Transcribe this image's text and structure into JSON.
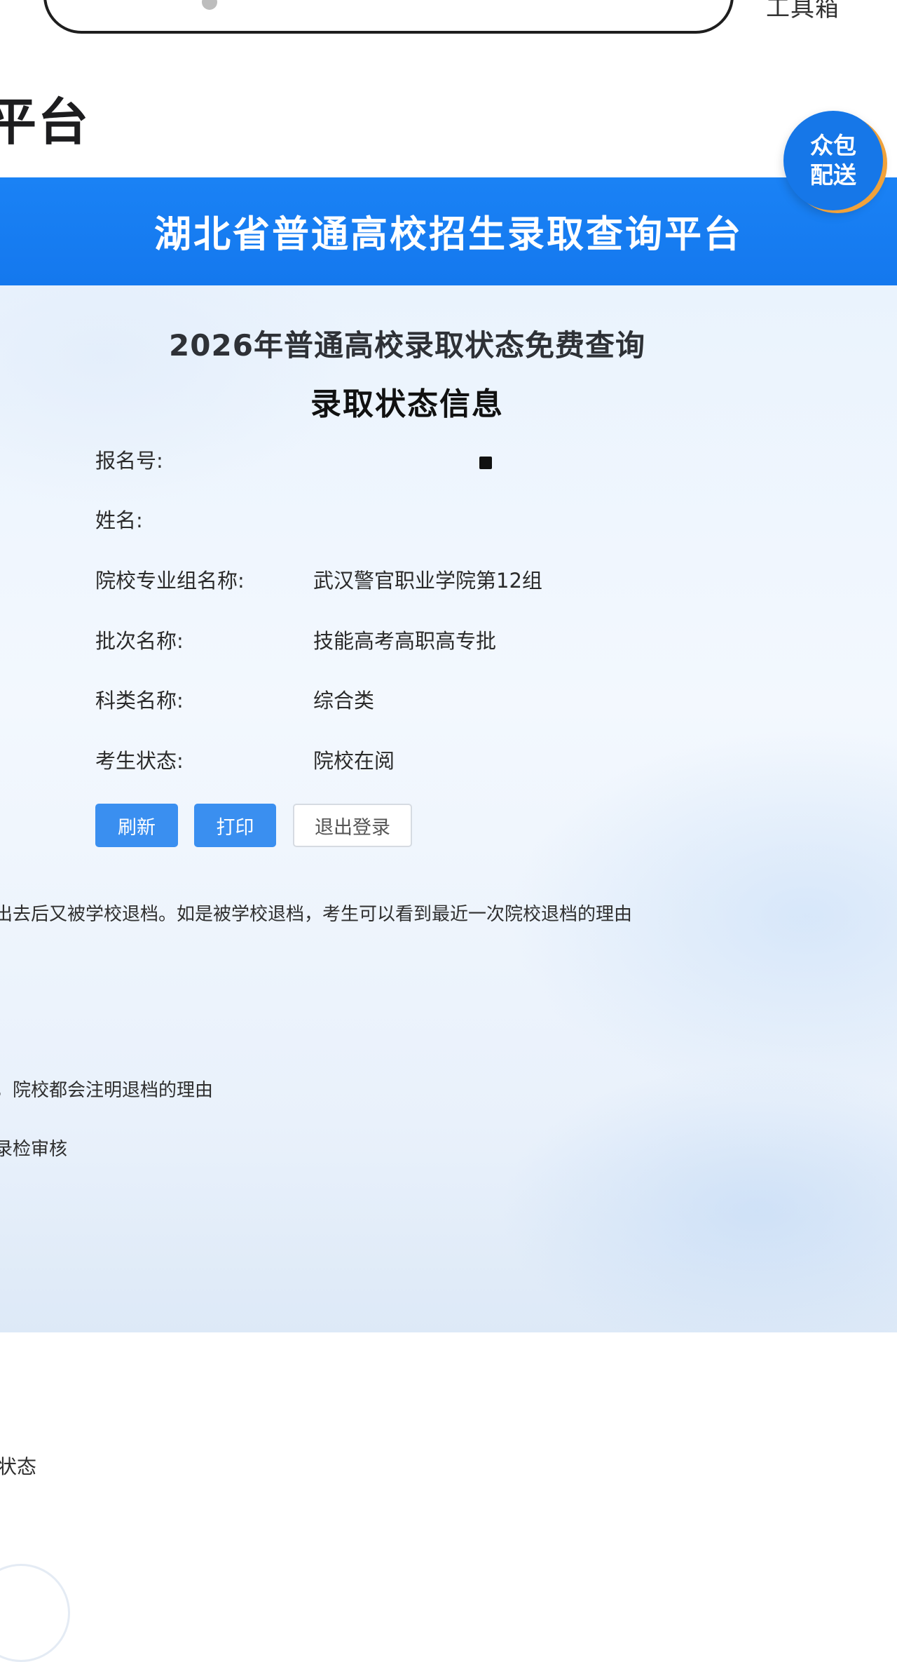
{
  "header": {
    "toolbox_label": "工具箱",
    "site_title_fragment": "平台"
  },
  "badge": {
    "text": "众包配送"
  },
  "banner": {
    "title": "湖北省普通高校招生录取查询平台"
  },
  "panel": {
    "heading": "2026年普通高校录取状态免费查询",
    "subheading": "录取状态信息",
    "rows": [
      {
        "label": "报名号:",
        "value": ""
      },
      {
        "label": "姓名:",
        "value": ""
      },
      {
        "label": "院校专业组名称:",
        "value": "武汉警官职业学院第12组"
      },
      {
        "label": "批次名称:",
        "value": "技能高考高职高专批"
      },
      {
        "label": "科类名称:",
        "value": "综合类"
      },
      {
        "label": "考生状态:",
        "value": "院校在阅"
      }
    ],
    "buttons": {
      "refresh": "刷新",
      "print": "打印",
      "logout": "退出登录"
    },
    "notes": [
      "出去后又被学校退档。如是被学校退档，考生可以看到最近一次院校退档的理由",
      "，院校都会注明退档的理由",
      "录检审核"
    ]
  },
  "footer": {
    "note_fragment": "状态"
  },
  "colors": {
    "banner_blue": "#1478ee",
    "button_blue": "#3a8ff0",
    "badge_blue": "#1677e8",
    "badge_ring": "#f0a23b"
  }
}
